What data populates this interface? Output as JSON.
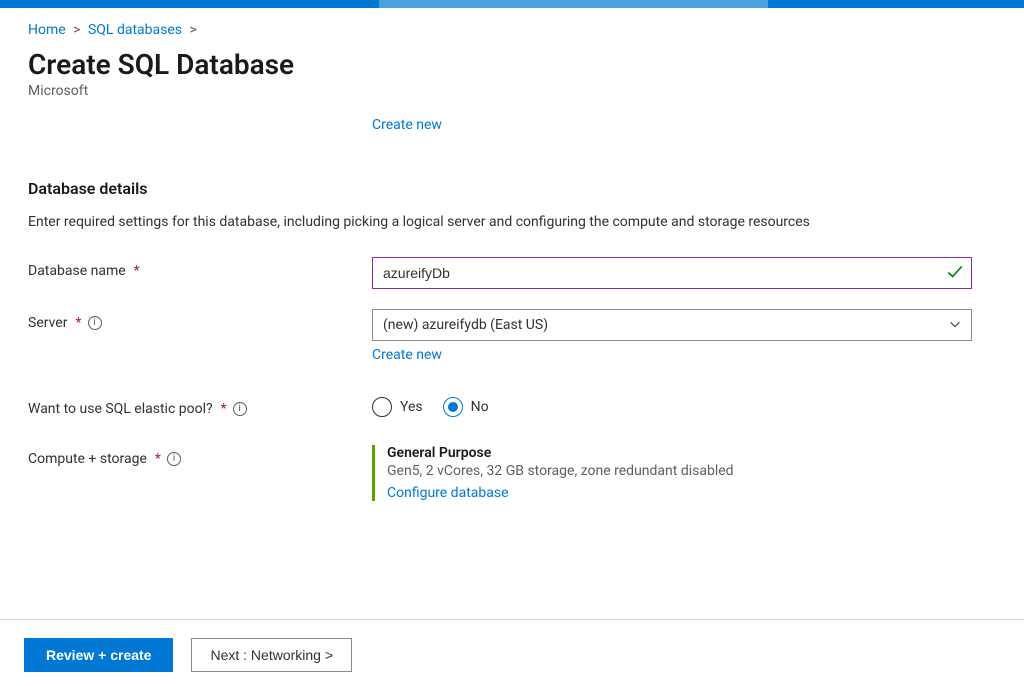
{
  "breadcrumb": {
    "home": "Home",
    "sql_databases": "SQL databases"
  },
  "page": {
    "title": "Create SQL Database",
    "subtitle": "Microsoft",
    "create_new_top": "Create new"
  },
  "section": {
    "title": "Database details",
    "description": "Enter required settings for this database, including picking a logical server and configuring the compute and storage resources"
  },
  "fields": {
    "database_name": {
      "label": "Database name",
      "value": "azureifyDb"
    },
    "server": {
      "label": "Server",
      "value": "(new) azureifydb (East US)",
      "create_new": "Create new"
    },
    "elastic_pool": {
      "label": "Want to use SQL elastic pool?",
      "options": {
        "yes": "Yes",
        "no": "No"
      },
      "selected": "no"
    },
    "compute": {
      "label": "Compute + storage",
      "title": "General Purpose",
      "description": "Gen5, 2 vCores, 32 GB storage, zone redundant disabled",
      "configure": "Configure database"
    }
  },
  "footer": {
    "review": "Review + create",
    "next": "Next : Networking >"
  }
}
